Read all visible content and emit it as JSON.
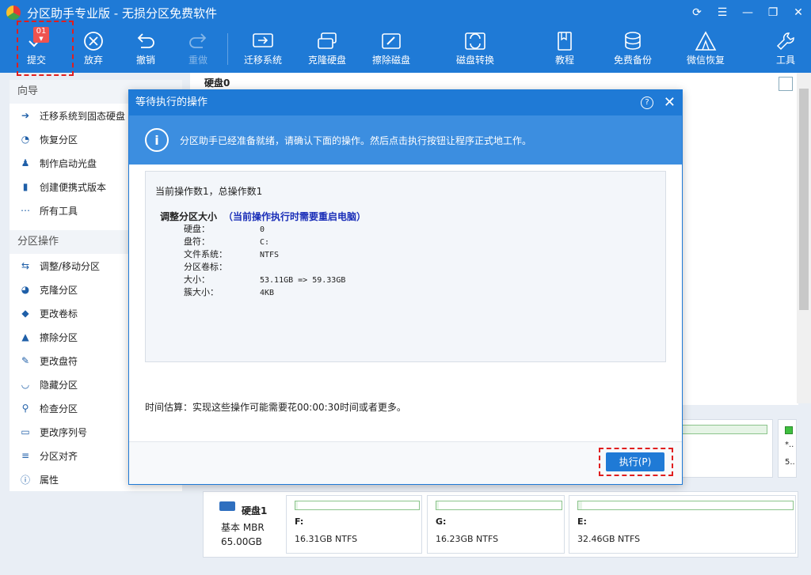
{
  "app": {
    "title": "分区助手专业版 - 无损分区免费软件"
  },
  "toolbar": {
    "commit": {
      "label": "提交",
      "badge": "01"
    },
    "discard": "放弃",
    "undo": "撤销",
    "redo": "重做",
    "migrate": "迁移系统",
    "clone": "克隆硬盘",
    "wipe": "擦除磁盘",
    "convert": "磁盘转换",
    "tutorial": "教程",
    "backup": "免费备份",
    "wechat": "微信恢复",
    "tools": "工具"
  },
  "sidebar": {
    "wizard_header": "向导",
    "wizard_items": [
      "迁移系统到固态硬盘",
      "恢复分区",
      "制作启动光盘",
      "创建便携式版本",
      "所有工具"
    ],
    "ops_header": "分区操作",
    "ops_items": [
      "调整/移动分区",
      "克隆分区",
      "更改卷标",
      "擦除分区",
      "更改盘符",
      "隐藏分区",
      "检查分区",
      "更改序列号",
      "分区对齐",
      "属性"
    ]
  },
  "main": {
    "disk0_title": "硬盘0",
    "disk1": {
      "title": "硬盘1",
      "type": "基本 MBR",
      "size": "65.00GB"
    },
    "partitions": [
      {
        "name": "F:",
        "info": "16.31GB NTFS"
      },
      {
        "name": "G:",
        "info": "16.23GB NTFS"
      },
      {
        "name": "E:",
        "info": "32.46GB NTFS"
      }
    ],
    "right_partial": {
      "name": "*..",
      "info": "5.."
    }
  },
  "dialog": {
    "title": "等待执行的操作",
    "banner": "分区助手已经准备就绪，请确认下面的操作。然后点击执行按钮让程序正式地工作。",
    "ops_count": "当前操作数1，总操作数1",
    "op_title": "调整分区大小",
    "op_note": "（当前操作执行时需要重启电脑）",
    "details": [
      {
        "k": "硬盘：",
        "v": "0"
      },
      {
        "k": "盘符：",
        "v": "C:"
      },
      {
        "k": "文件系统：",
        "v": "NTFS"
      },
      {
        "k": "分区卷标：",
        "v": ""
      },
      {
        "k": "大小：",
        "v": "53.11GB => 59.33GB"
      },
      {
        "k": "簇大小：",
        "v": "4KB"
      }
    ],
    "estimate": "时间估算：实现这些操作可能需要花00:00:30时间或者更多。",
    "execute_label": "执行(P)"
  },
  "colors": {
    "accent": "#1f7ad6",
    "highlight": "#e01e1e",
    "note": "#1a2eb8"
  }
}
